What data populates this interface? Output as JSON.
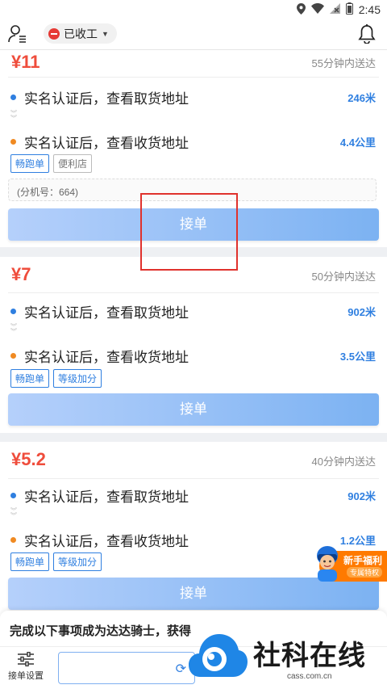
{
  "status_bar": {
    "time": "2:45",
    "icons": [
      "location-icon",
      "wifi-icon",
      "no-signal-icon",
      "battery-icon"
    ]
  },
  "topbar": {
    "status_label": "已收工",
    "status_color": "#e63a35"
  },
  "orders": [
    {
      "price": "¥11",
      "eta": "55分钟内送达",
      "pickup": {
        "address": "实名认证后，查看取货地址",
        "distance": "246米"
      },
      "delivery": {
        "address": "实名认证后，查看收货地址",
        "distance": "4.4公里"
      },
      "tags": [
        "畅跑单",
        "便利店"
      ],
      "extension": "(分机号：664)",
      "accept_label": "接单"
    },
    {
      "price": "¥7",
      "eta": "50分钟内送达",
      "pickup": {
        "address": "实名认证后，查看取货地址",
        "distance": "902米"
      },
      "delivery": {
        "address": "实名认证后，查看收货地址",
        "distance": "3.5公里"
      },
      "tags": [
        "畅跑单",
        "等级加分"
      ],
      "accept_label": "接单"
    },
    {
      "price": "¥5.2",
      "eta": "40分钟内送达",
      "pickup": {
        "address": "实名认证后，查看取货地址",
        "distance": "902米"
      },
      "delivery": {
        "address": "实名认证后，查看收货地址",
        "distance": "1.2公里"
      },
      "tags": [
        "畅跑单",
        "等级加分"
      ],
      "accept_label": "接单"
    }
  ],
  "promo": {
    "title": "新手福利",
    "subtitle": "专属特权"
  },
  "bottom_sheet": {
    "text": "完成以下事项成为达达骑士，获得"
  },
  "tabbar": {
    "settings_label": "接单设置"
  },
  "watermark": {
    "text": "社科在线",
    "url": "cass.com.cn"
  },
  "colors": {
    "accent": "#2f7fe0",
    "price": "#ef4d3c",
    "orange": "#f08a22"
  }
}
